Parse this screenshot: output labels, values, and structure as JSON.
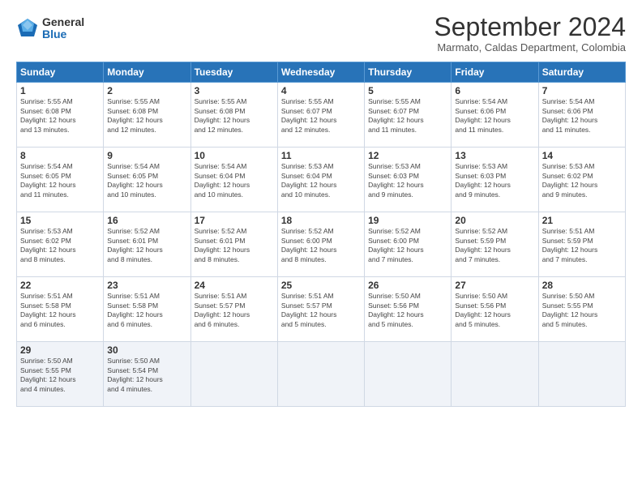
{
  "logo": {
    "general": "General",
    "blue": "Blue"
  },
  "title": "September 2024",
  "subtitle": "Marmato, Caldas Department, Colombia",
  "days_header": [
    "Sunday",
    "Monday",
    "Tuesday",
    "Wednesday",
    "Thursday",
    "Friday",
    "Saturday"
  ],
  "weeks": [
    [
      {
        "day": "1",
        "sunrise": "5:55 AM",
        "sunset": "6:08 PM",
        "daylight": "12 hours and 13 minutes."
      },
      {
        "day": "2",
        "sunrise": "5:55 AM",
        "sunset": "6:08 PM",
        "daylight": "12 hours and 12 minutes."
      },
      {
        "day": "3",
        "sunrise": "5:55 AM",
        "sunset": "6:08 PM",
        "daylight": "12 hours and 12 minutes."
      },
      {
        "day": "4",
        "sunrise": "5:55 AM",
        "sunset": "6:07 PM",
        "daylight": "12 hours and 12 minutes."
      },
      {
        "day": "5",
        "sunrise": "5:55 AM",
        "sunset": "6:07 PM",
        "daylight": "12 hours and 11 minutes."
      },
      {
        "day": "6",
        "sunrise": "5:54 AM",
        "sunset": "6:06 PM",
        "daylight": "12 hours and 11 minutes."
      },
      {
        "day": "7",
        "sunrise": "5:54 AM",
        "sunset": "6:06 PM",
        "daylight": "12 hours and 11 minutes."
      }
    ],
    [
      {
        "day": "8",
        "sunrise": "5:54 AM",
        "sunset": "6:05 PM",
        "daylight": "12 hours and 11 minutes."
      },
      {
        "day": "9",
        "sunrise": "5:54 AM",
        "sunset": "6:05 PM",
        "daylight": "12 hours and 10 minutes."
      },
      {
        "day": "10",
        "sunrise": "5:54 AM",
        "sunset": "6:04 PM",
        "daylight": "12 hours and 10 minutes."
      },
      {
        "day": "11",
        "sunrise": "5:53 AM",
        "sunset": "6:04 PM",
        "daylight": "12 hours and 10 minutes."
      },
      {
        "day": "12",
        "sunrise": "5:53 AM",
        "sunset": "6:03 PM",
        "daylight": "12 hours and 9 minutes."
      },
      {
        "day": "13",
        "sunrise": "5:53 AM",
        "sunset": "6:03 PM",
        "daylight": "12 hours and 9 minutes."
      },
      {
        "day": "14",
        "sunrise": "5:53 AM",
        "sunset": "6:02 PM",
        "daylight": "12 hours and 9 minutes."
      }
    ],
    [
      {
        "day": "15",
        "sunrise": "5:53 AM",
        "sunset": "6:02 PM",
        "daylight": "12 hours and 8 minutes."
      },
      {
        "day": "16",
        "sunrise": "5:52 AM",
        "sunset": "6:01 PM",
        "daylight": "12 hours and 8 minutes."
      },
      {
        "day": "17",
        "sunrise": "5:52 AM",
        "sunset": "6:01 PM",
        "daylight": "12 hours and 8 minutes."
      },
      {
        "day": "18",
        "sunrise": "5:52 AM",
        "sunset": "6:00 PM",
        "daylight": "12 hours and 8 minutes."
      },
      {
        "day": "19",
        "sunrise": "5:52 AM",
        "sunset": "6:00 PM",
        "daylight": "12 hours and 7 minutes."
      },
      {
        "day": "20",
        "sunrise": "5:52 AM",
        "sunset": "5:59 PM",
        "daylight": "12 hours and 7 minutes."
      },
      {
        "day": "21",
        "sunrise": "5:51 AM",
        "sunset": "5:59 PM",
        "daylight": "12 hours and 7 minutes."
      }
    ],
    [
      {
        "day": "22",
        "sunrise": "5:51 AM",
        "sunset": "5:58 PM",
        "daylight": "12 hours and 6 minutes."
      },
      {
        "day": "23",
        "sunrise": "5:51 AM",
        "sunset": "5:58 PM",
        "daylight": "12 hours and 6 minutes."
      },
      {
        "day": "24",
        "sunrise": "5:51 AM",
        "sunset": "5:57 PM",
        "daylight": "12 hours and 6 minutes."
      },
      {
        "day": "25",
        "sunrise": "5:51 AM",
        "sunset": "5:57 PM",
        "daylight": "12 hours and 5 minutes."
      },
      {
        "day": "26",
        "sunrise": "5:50 AM",
        "sunset": "5:56 PM",
        "daylight": "12 hours and 5 minutes."
      },
      {
        "day": "27",
        "sunrise": "5:50 AM",
        "sunset": "5:56 PM",
        "daylight": "12 hours and 5 minutes."
      },
      {
        "day": "28",
        "sunrise": "5:50 AM",
        "sunset": "5:55 PM",
        "daylight": "12 hours and 5 minutes."
      }
    ],
    [
      {
        "day": "29",
        "sunrise": "5:50 AM",
        "sunset": "5:55 PM",
        "daylight": "12 hours and 4 minutes."
      },
      {
        "day": "30",
        "sunrise": "5:50 AM",
        "sunset": "5:54 PM",
        "daylight": "12 hours and 4 minutes."
      },
      null,
      null,
      null,
      null,
      null
    ]
  ],
  "labels": {
    "sunrise": "Sunrise:",
    "sunset": "Sunset:",
    "daylight": "Daylight:"
  }
}
